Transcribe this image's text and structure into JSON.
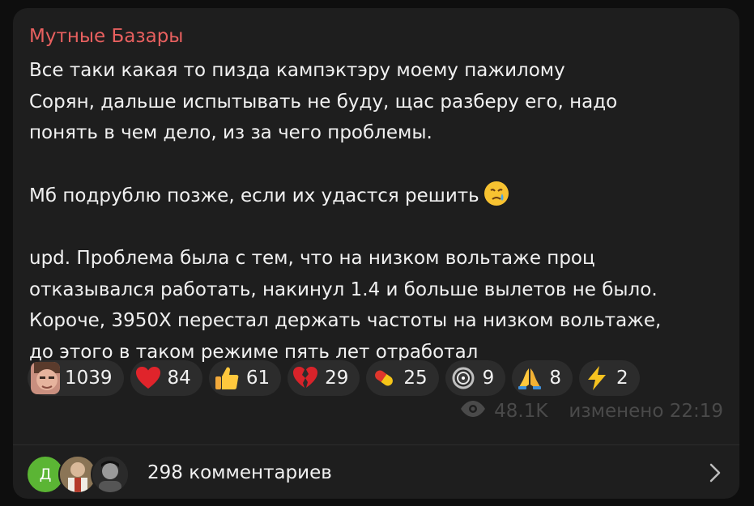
{
  "post": {
    "author": "Мутные Базары",
    "text_line1": "Все таки какая то пизда кампэктэру моему пажилому",
    "text_line2": "Сорян, дальше испытывать не буду, щас разберу его, надо",
    "text_line3": "понять в чем дело, из за чего проблемы.",
    "text_line4": "Мб подрублю позже, если их удастся решить",
    "text_line5": "upd. Проблема была с тем, что на низком вольтаже проц",
    "text_line6": "отказывался работать, накинул 1.4 и больше вылетов не было.",
    "text_line7": "Короче, 3950X перестал держать частоты на низком вольтаже,",
    "text_line8": "до этого в таком режиме пять лет отработал",
    "inline_emoji": "crying-face-icon"
  },
  "reactions": [
    {
      "icon": "custom-avatar-face",
      "count": "1039"
    },
    {
      "icon": "red-heart-icon",
      "count": "84"
    },
    {
      "icon": "thumbs-up-icon",
      "count": "61"
    },
    {
      "icon": "broken-heart-icon",
      "count": "29"
    },
    {
      "icon": "pill-icon",
      "count": "25"
    },
    {
      "icon": "ring-icon",
      "count": "9"
    },
    {
      "icon": "praying-hands-icon",
      "count": "8"
    },
    {
      "icon": "lightning-icon",
      "count": "2"
    }
  ],
  "meta": {
    "views": "48.1K",
    "edited_time": "изменено 22:19"
  },
  "comments": {
    "avatar_letter": "Д",
    "label": "298 комментариев"
  },
  "colors": {
    "background": "#0e0e0e",
    "bubble": "#1e1e1e",
    "author": "#e8605f",
    "reaction_bg": "#2c2c2c",
    "meta": "#4a4a4a"
  }
}
